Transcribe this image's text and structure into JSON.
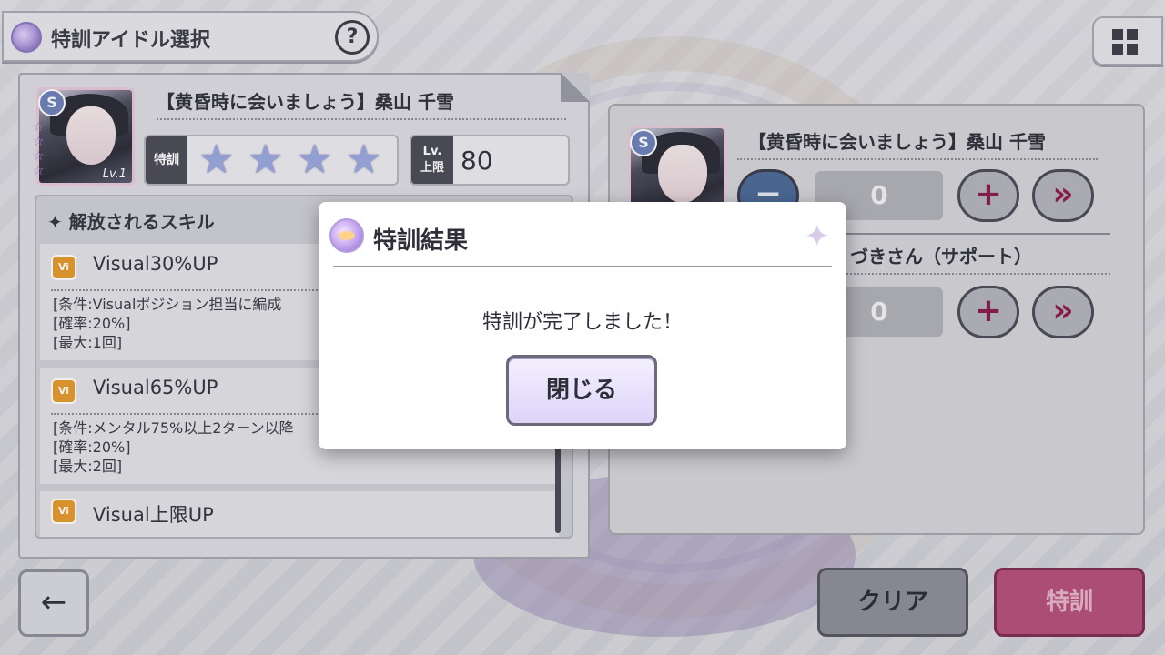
{
  "header": {
    "title": "特訓アイドル選択",
    "help_symbol": "?"
  },
  "card": {
    "name": "【黄昏時に会いましょう】桑山 千雪",
    "level_badge": "Lv.1",
    "rarity_badge": "S",
    "tokkun_label": "特訓",
    "star_count": 4,
    "lv_cap_label_top": "Lv.",
    "lv_cap_label_bottom": "上限",
    "lv_cap_value": "80"
  },
  "skills": {
    "title": "✦ 解放されるスキル",
    "items": [
      {
        "icon": "Vi",
        "name": "Visual30%UP",
        "desc": [
          "[条件:Visualポジション担当に編成",
          "[確率:20%]",
          "[最大:1回]"
        ]
      },
      {
        "icon": "Vi",
        "name": "Visual65%UP",
        "desc": [
          "[条件:メンタル75%以上2ターン以降",
          "[確率:20%]",
          "[最大:2回]"
        ]
      },
      {
        "icon": "Vi",
        "name": "Visual上限UP",
        "desc": []
      }
    ]
  },
  "right": {
    "card_name": "【黄昏時に会いましょう】桑山 千雪",
    "count1": "0",
    "support_name": "づきさん（サポート）",
    "count2": "0",
    "minus_symbol": "−",
    "plus_symbol": "+",
    "max_symbol": "»"
  },
  "footer": {
    "back_symbol": "←",
    "clear_label": "クリア",
    "tokkun_label": "特訓"
  },
  "modal": {
    "title": "特訓結果",
    "message": "特訓が完了しました！",
    "close_label": "閉じる"
  },
  "colors": {
    "accent_pink": "#b54f7a",
    "modal_bg": "#ffffff",
    "button_lavender": "#ddd4f8"
  }
}
